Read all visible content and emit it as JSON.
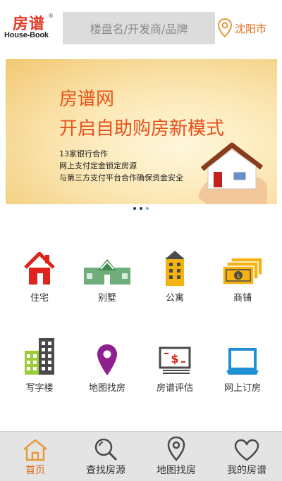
{
  "header": {
    "logo": {
      "cn": "房谱",
      "reg": "®",
      "en": "House-Book"
    },
    "search_placeholder": "楼盘名/开发商/品牌",
    "city": "沈阳市"
  },
  "banner": {
    "title1": "房谱网",
    "title2": "开启自助购房新模式",
    "lines": [
      "13家银行合作",
      "网上支付定金锁定房源",
      "与第三方支付平台合作确保资金安全"
    ],
    "page_count": 3,
    "active_index": 2
  },
  "categories": [
    {
      "label": "住宅",
      "icon": "house-icon"
    },
    {
      "label": "别墅",
      "icon": "villa-icon"
    },
    {
      "label": "公寓",
      "icon": "apartment-icon"
    },
    {
      "label": "商铺",
      "icon": "money-icon"
    },
    {
      "label": "写字楼",
      "icon": "office-building-icon"
    },
    {
      "label": "地图找房",
      "icon": "map-pin-icon"
    },
    {
      "label": "房谱评估",
      "icon": "price-tag-icon"
    },
    {
      "label": "网上订房",
      "icon": "laptop-icon"
    }
  ],
  "tabbar": [
    {
      "label": "首页",
      "icon": "home-icon",
      "active": true
    },
    {
      "label": "查找房源",
      "icon": "search-icon",
      "active": false
    },
    {
      "label": "地图找房",
      "icon": "location-icon",
      "active": false
    },
    {
      "label": "我的房谱",
      "icon": "heart-icon",
      "active": false
    }
  ],
  "colors": {
    "accent": "#e56a14",
    "brand_red": "#e23a26",
    "tabbar_bg": "#e4e4e4"
  }
}
